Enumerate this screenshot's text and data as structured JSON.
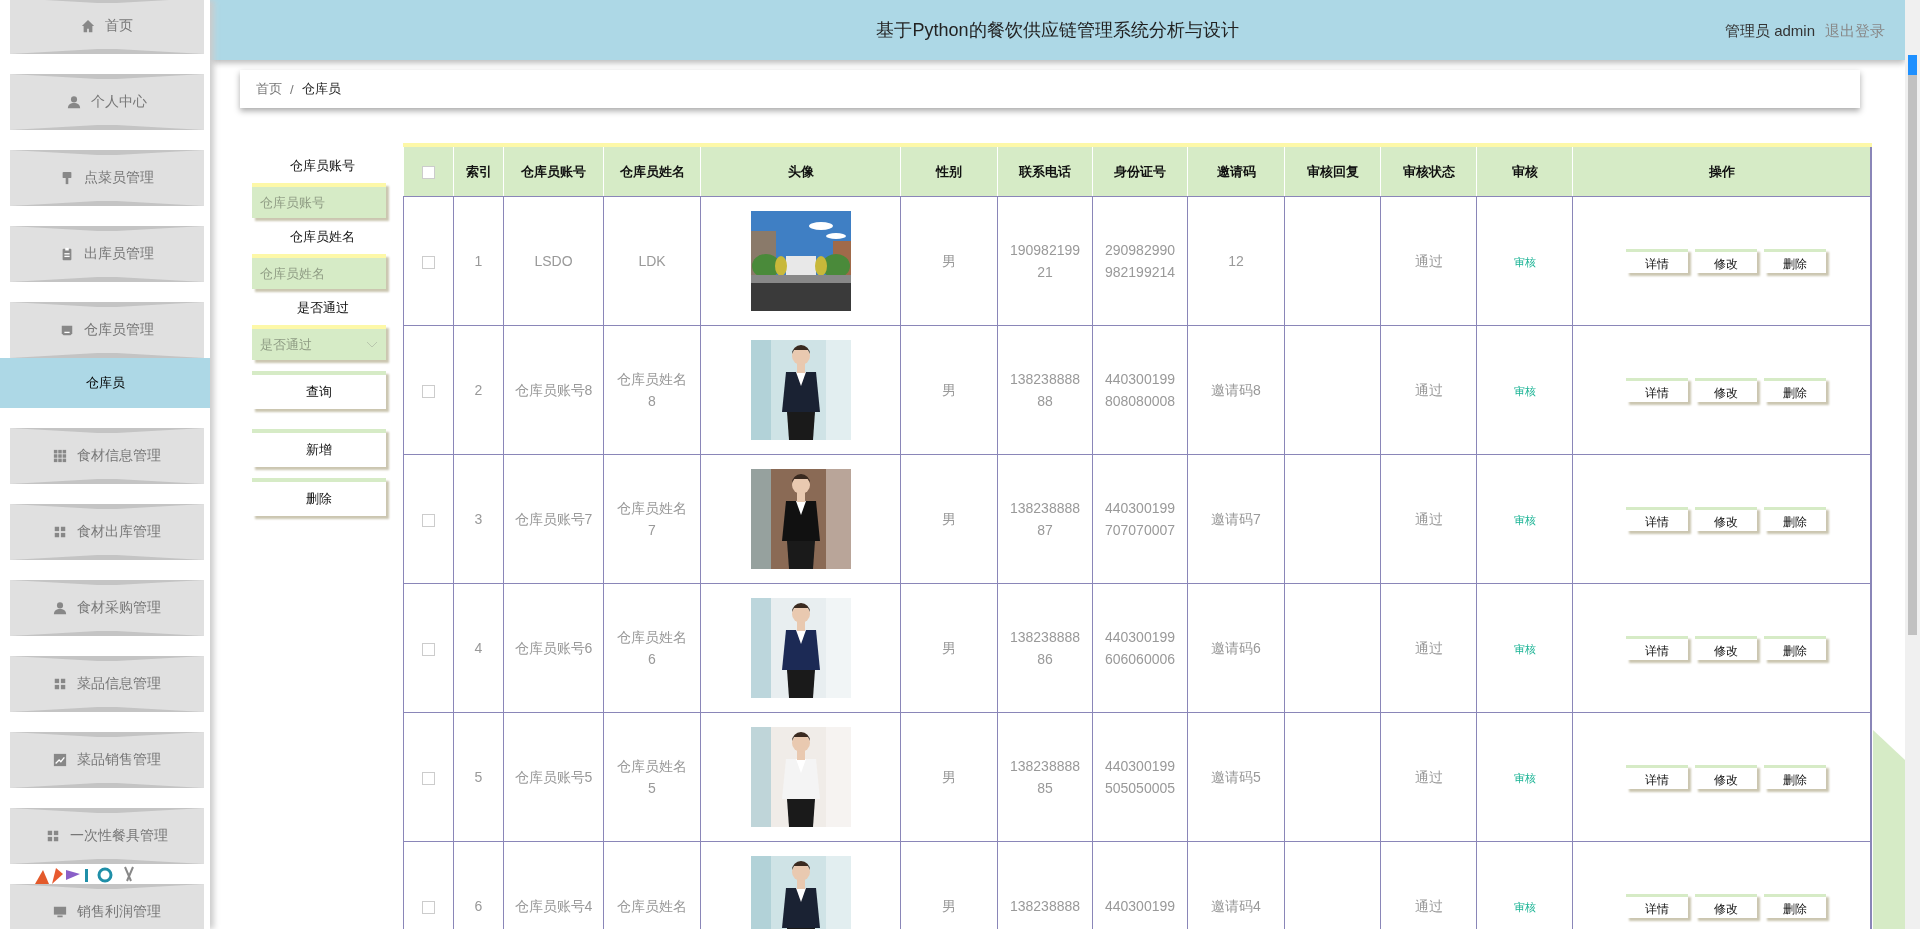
{
  "sidebar": {
    "items": [
      {
        "label": "首页"
      },
      {
        "label": "个人中心"
      },
      {
        "label": "点菜员管理"
      },
      {
        "label": "出库员管理"
      },
      {
        "label": "仓库员管理",
        "children": [
          {
            "label": "仓库员",
            "selected": true
          }
        ]
      },
      {
        "label": "食材信息管理"
      },
      {
        "label": "食材出库管理"
      },
      {
        "label": "食材采购管理"
      },
      {
        "label": "菜品信息管理"
      },
      {
        "label": "菜品销售管理"
      },
      {
        "label": "一次性餐具管理"
      },
      {
        "label": "销售利润管理"
      }
    ]
  },
  "header": {
    "title": "基于Python的餐饮供应链管理系统分析与设计",
    "user": "管理员 admin",
    "logout": "退出登录"
  },
  "breadcrumb": {
    "items": [
      "首页",
      "仓库员"
    ],
    "separator": "/"
  },
  "search": {
    "fields": [
      {
        "kind": "input",
        "label": "仓库员账号",
        "placeholder": "仓库员账号"
      },
      {
        "kind": "input",
        "label": "仓库员姓名",
        "placeholder": "仓库员姓名"
      },
      {
        "kind": "select",
        "label": "是否通过",
        "placeholder": "是否通过"
      }
    ],
    "buttons": [
      "查询",
      "新增",
      "删除"
    ]
  },
  "table": {
    "select_all_checked": false,
    "columns": [
      "索引",
      "仓库员账号",
      "仓库员姓名",
      "头像",
      "性别",
      "联系电话",
      "身份证号",
      "邀请码",
      "审核回复",
      "审核状态",
      "审核",
      "操作"
    ],
    "rows": [
      {
        "checked": false,
        "index": "1",
        "account": "LSDO",
        "name": "LDK",
        "gender": "男",
        "phone": "19098219921",
        "id_number": "290982990982199214",
        "invite_code": "12",
        "status": "通过",
        "review": "审核",
        "actions": [
          "详情",
          "修改",
          "删除"
        ]
      },
      {
        "checked": false,
        "index": "2",
        "account": "仓库员账号8",
        "name": "仓库员姓名8",
        "gender": "男",
        "phone": "13823888888",
        "id_number": "440300199808080008",
        "invite_code": "邀请码8",
        "status": "通过",
        "review": "审核",
        "actions": [
          "详情",
          "修改",
          "删除"
        ]
      },
      {
        "checked": false,
        "index": "3",
        "account": "仓库员账号7",
        "name": "仓库员姓名7",
        "gender": "男",
        "phone": "13823888887",
        "id_number": "440300199707070007",
        "invite_code": "邀请码7",
        "status": "通过",
        "review": "审核",
        "actions": [
          "详情",
          "修改",
          "删除"
        ]
      },
      {
        "checked": false,
        "index": "4",
        "account": "仓库员账号6",
        "name": "仓库员姓名6",
        "gender": "男",
        "phone": "13823888886",
        "id_number": "440300199606060006",
        "invite_code": "邀请码6",
        "status": "通过",
        "review": "审核",
        "actions": [
          "详情",
          "修改",
          "删除"
        ]
      },
      {
        "checked": false,
        "index": "5",
        "account": "仓库员账号5",
        "name": "仓库员姓名5",
        "gender": "男",
        "phone": "13823888885",
        "id_number": "440300199505050005",
        "invite_code": "邀请码5",
        "status": "通过",
        "review": "审核",
        "actions": [
          "详情",
          "修改",
          "删除"
        ]
      },
      {
        "checked": false,
        "index": "6",
        "account": "仓库员账号4",
        "name": "仓库员姓名",
        "gender": "男",
        "phone": "138238888",
        "id_number": "440300199",
        "invite_code": "邀请码4",
        "status": "通过",
        "review": "审核",
        "actions": [
          "详情",
          "修改",
          "删除"
        ]
      }
    ]
  }
}
